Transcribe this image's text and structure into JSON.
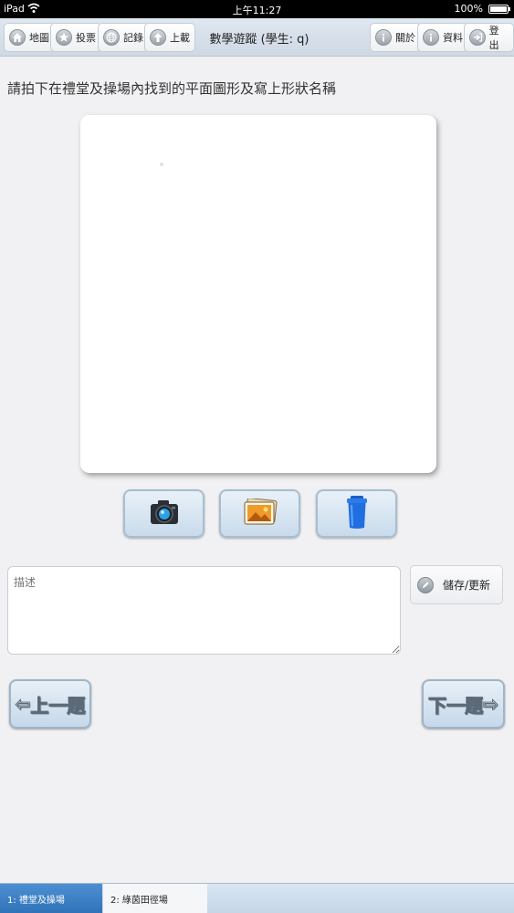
{
  "status_bar": {
    "carrier": "iPad",
    "time": "上午11:27",
    "battery": "100%",
    "battery_level": 1.0
  },
  "toolbar": {
    "title": "數學遊蹤 (學生: q)",
    "left_buttons": [
      {
        "label": "地圖",
        "icon": "home-icon"
      },
      {
        "label": "投票",
        "icon": "star-icon"
      },
      {
        "label": "記錄",
        "icon": "globe-icon"
      },
      {
        "label": "上載",
        "icon": "upload-icon"
      }
    ],
    "right_buttons": [
      {
        "label": "關於",
        "icon": "info-icon"
      },
      {
        "label": "資料",
        "icon": "info-icon"
      },
      {
        "label": "登出",
        "icon": "logout-icon"
      }
    ]
  },
  "question": {
    "text": "請拍下在禮堂及操場內找到的平面圖形及寫上形狀名稱"
  },
  "actions": [
    {
      "name": "camera-button",
      "icon": "camera-icon"
    },
    {
      "name": "photo-library-button",
      "icon": "photo-icon"
    },
    {
      "name": "delete-button",
      "icon": "trash-icon"
    }
  ],
  "description": {
    "placeholder": "描述",
    "value": ""
  },
  "save_button": {
    "label": "儲存/更新"
  },
  "navigation": {
    "prev_label": "上一題",
    "next_label": "下一題"
  },
  "tabs": [
    {
      "label": "1: 禮堂及操場",
      "active": true
    },
    {
      "label": "2: 綠茵田徑場",
      "active": false
    }
  ],
  "colors": {
    "accent": "#2f72b8",
    "toolbar": "#d6e0ea",
    "button_face": "#c8dbec"
  }
}
